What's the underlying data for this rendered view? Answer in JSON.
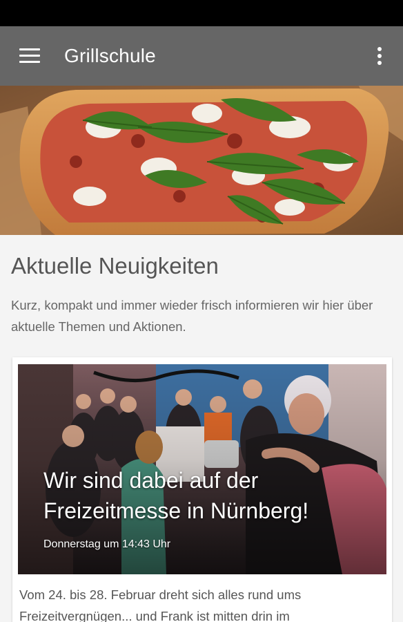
{
  "app_bar": {
    "title": "Grillschule",
    "menu_icon": "hamburger-menu-icon",
    "overflow_icon": "more-vertical-icon",
    "background": "#666666"
  },
  "hero": {
    "image": "flatbread-pizza-with-arugula-photo"
  },
  "news": {
    "heading": "Aktuelle Neuigkeiten",
    "intro": "Kurz, kompakt und immer wieder frisch informieren wir hier über aktuelle Themen und Aktionen.",
    "articles": [
      {
        "title": "Wir sind dabei auf der Freizeitmesse in Nürnberg!",
        "date": "Donnerstag um 14:43 Uhr",
        "excerpt": "Vom 24. bis 28. Februar dreht sich alles rund ums Freizeitvergnügen... und Frank ist mitten drin im",
        "image": "group-photo-at-trade-fair"
      }
    ]
  }
}
